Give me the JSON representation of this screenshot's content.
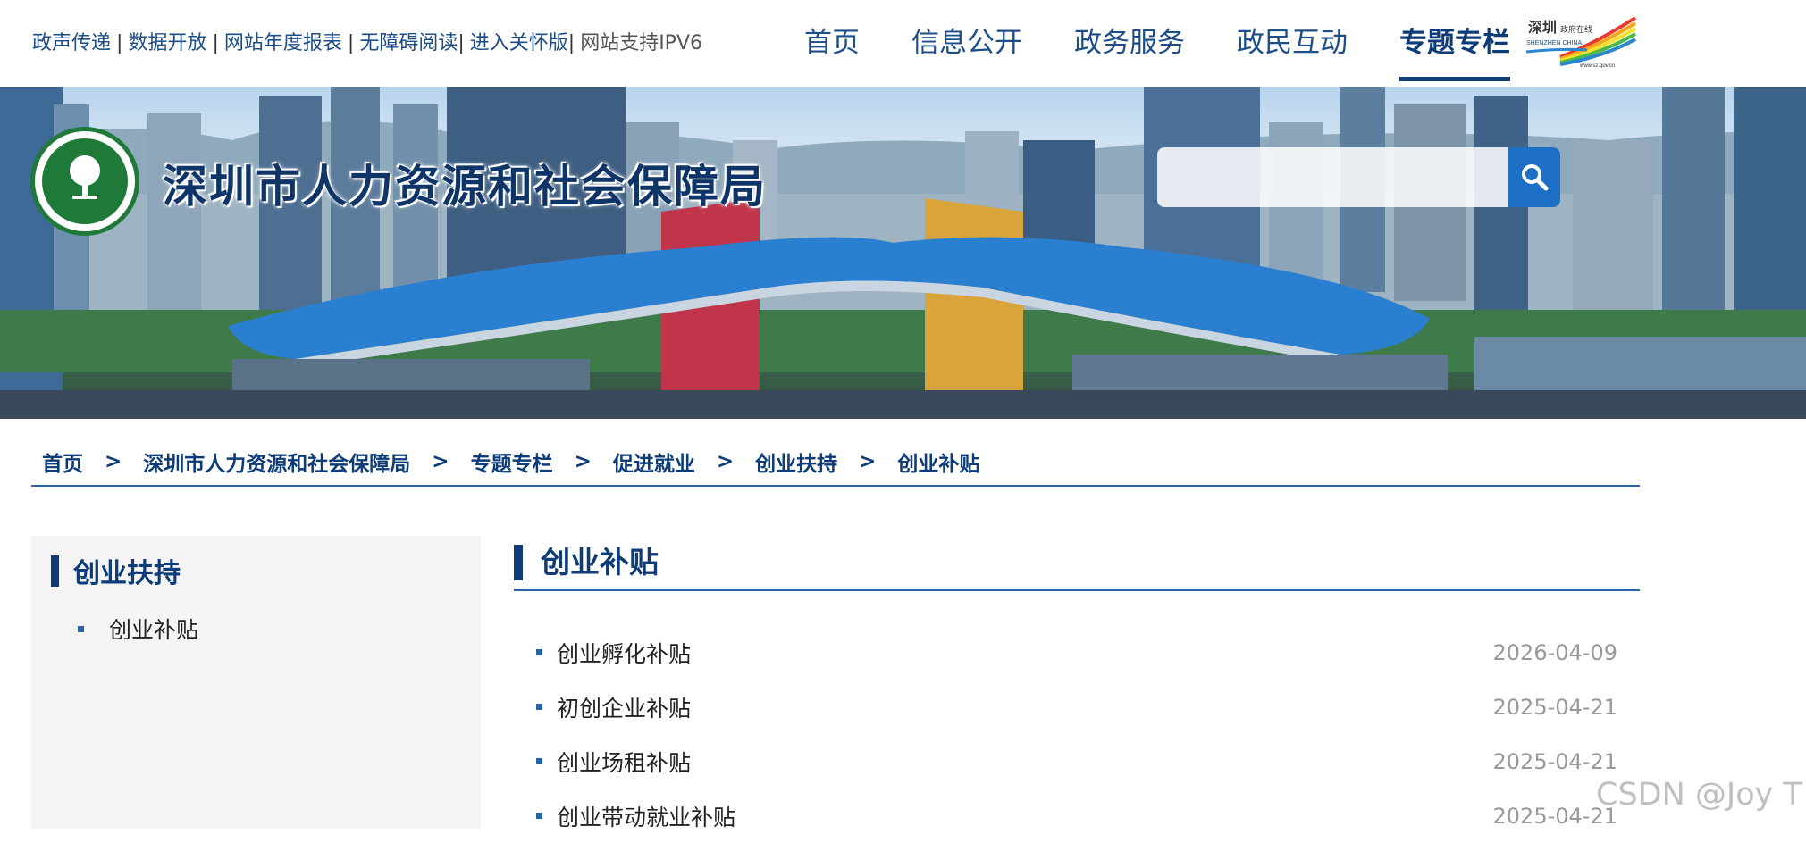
{
  "topbar": {
    "quick_links": [
      "政声传递",
      "数据开放",
      "网站年度报表",
      "无障碍阅读",
      "进入关怀版",
      "网站支持IPV6"
    ],
    "nav": [
      "首页",
      "信息公开",
      "政务服务",
      "政民互动",
      "专题专栏"
    ],
    "active_nav": "专题专栏",
    "logo_text": "深圳政府在线",
    "logo_subtext": "SHENZHEN CHINA",
    "logo_url": "www.sz.gov.cn"
  },
  "banner": {
    "site_title": "深圳市人力资源和社会保障局",
    "search_placeholder": ""
  },
  "breadcrumb": [
    "首页",
    "深圳市人力资源和社会保障局",
    "专题专栏",
    "促进就业",
    "创业扶持",
    "创业补贴"
  ],
  "sidebar": {
    "heading": "创业扶持",
    "items": [
      "创业补贴"
    ]
  },
  "main": {
    "heading": "创业补贴",
    "articles": [
      {
        "title": "创业孵化补贴",
        "date": "2026-04-09"
      },
      {
        "title": "初创企业补贴",
        "date": "2025-04-21"
      },
      {
        "title": "创业场租补贴",
        "date": "2025-04-21"
      },
      {
        "title": "创业带动就业补贴",
        "date": "2025-04-21"
      }
    ]
  },
  "watermark": "CSDN @Joy T",
  "colors": {
    "primary": "#0d3c78",
    "link": "#1d4e89",
    "accent": "#1c6fc4",
    "date": "#999999",
    "sidebar_bg": "#f4f4f4"
  }
}
